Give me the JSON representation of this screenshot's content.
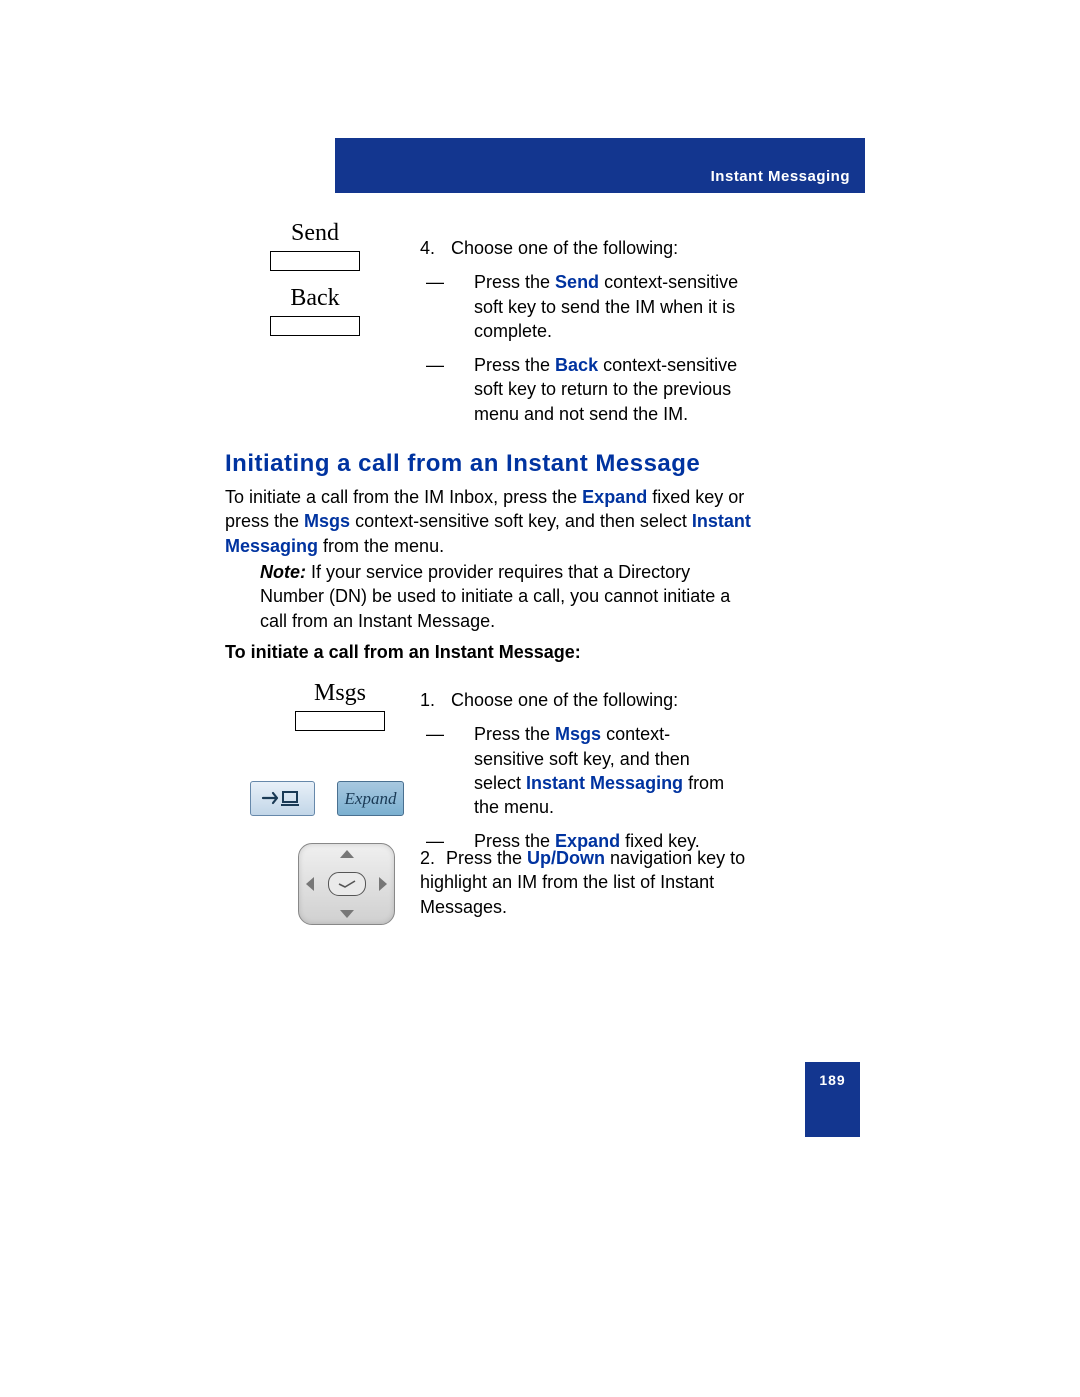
{
  "header": {
    "section": "Instant Messaging"
  },
  "softkeys": {
    "send": "Send",
    "back": "Back",
    "msgs": "Msgs"
  },
  "step4": {
    "num": "4.",
    "lead": "Choose one of the following:",
    "a_pre": "Press the ",
    "a_bold": "Send",
    "a_post": " context-sensitive soft key to send the IM when it is complete.",
    "b_pre": "Press the ",
    "b_bold": "Back",
    "b_post": " context-sensitive soft key to return to the previous menu and not send the IM."
  },
  "section_h2": "Initiating a call from an Instant Message",
  "intro": {
    "pre1": "To initiate a call from the IM Inbox, press the ",
    "b1": "Expand",
    "mid1": " fixed key or press the ",
    "b2": "Msgs",
    "mid2": " context-sensitive soft key, and then select ",
    "b3": "Instant Messaging",
    "post": " from the menu."
  },
  "note": {
    "label": "Note:",
    "text": "  If your service provider requires that a Directory Number (DN) be used to initiate a call, you cannot initiate a call from an Instant Message."
  },
  "proc_head": "To initiate a call from an Instant Message:",
  "expand_label": "Expand",
  "step1": {
    "num": "1.",
    "lead": "Choose one of the following:",
    "a_pre": "Press the ",
    "a_b1": "Msgs",
    "a_mid": " context-sensitive soft key, and then select ",
    "a_b2": "Instant Messaging",
    "a_post": " from the menu.",
    "b_pre": "Press the ",
    "b_bold": "Expand",
    "b_post": " fixed key."
  },
  "step2": {
    "num": "2.",
    "pre": "Press the ",
    "bold": "Up/Down",
    "post": " navigation key to highlight an IM from the list of Instant Messages."
  },
  "page_number": "189"
}
